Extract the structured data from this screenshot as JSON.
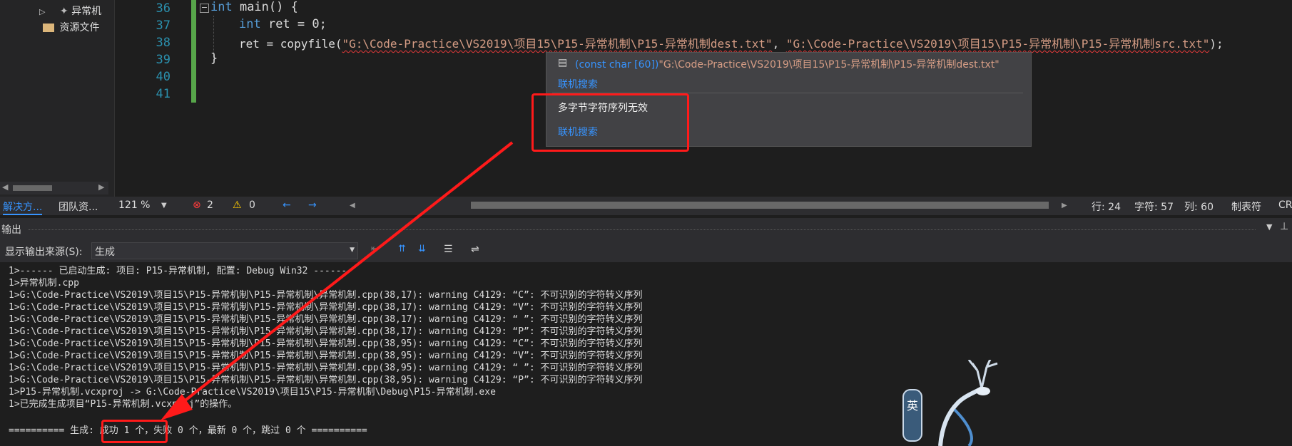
{
  "solution_explorer": {
    "items": [
      {
        "label": "异常机",
        "icon": "file-icon"
      },
      {
        "label": "资源文件",
        "icon": "folder-icon"
      }
    ],
    "tabs": [
      "解决方...",
      "团队资..."
    ]
  },
  "editor": {
    "line_numbers": [
      "36",
      "37",
      "38",
      "39",
      "40",
      "41"
    ],
    "code": {
      "l36_kw": "int",
      "l36_rest": " main() {",
      "l37_kw": "int",
      "l37_rest": " ret = 0;",
      "l38_pre": "ret = copyfile(",
      "l38_str1": "\"G:\\Code-Practice\\VS2019\\项目15\\P15-异常机制\\P15-异常机制dest.txt\"",
      "l38_mid": ", ",
      "l38_str2": "\"G:\\Code-Practice\\VS2019\\项目15\\P15-异常机制\\P15-异常机制src.txt\"",
      "l38_post": ");",
      "l39": "}"
    }
  },
  "tooltip": {
    "type_prefix": "(const char [60])",
    "value": "\"G:\\Code-Practice\\VS2019\\项目15\\P15-异常机制\\P15-异常机制dest.txt\"",
    "online_search_1": "联机搜索",
    "error_message": "多字节字符序列无效",
    "online_search_2": "联机搜索"
  },
  "editor_status": {
    "zoom": "121 %",
    "errors": "2",
    "warnings": "0",
    "row": "行: 24",
    "char": "字符: 57",
    "col": "列: 60",
    "tab_mode": "制表符",
    "line_ending": "CR"
  },
  "output_panel": {
    "title": "输出",
    "source_label": "显示输出来源(S):",
    "source_value": "生成",
    "lines": [
      "1>------ 已启动生成: 项目: P15-异常机制, 配置: Debug Win32 ------",
      "1>异常机制.cpp",
      "1>G:\\Code-Practice\\VS2019\\项目15\\P15-异常机制\\P15-异常机制\\异常机制.cpp(38,17): warning C4129: “C”: 不可识别的字符转义序列",
      "1>G:\\Code-Practice\\VS2019\\项目15\\P15-异常机制\\P15-异常机制\\异常机制.cpp(38,17): warning C4129: “V”: 不可识别的字符转义序列",
      "1>G:\\Code-Practice\\VS2019\\项目15\\P15-异常机制\\P15-异常机制\\异常机制.cpp(38,17): warning C4129: “ ”: 不可识别的字符转义序列",
      "1>G:\\Code-Practice\\VS2019\\项目15\\P15-异常机制\\P15-异常机制\\异常机制.cpp(38,17): warning C4129: “P”: 不可识别的字符转义序列",
      "1>G:\\Code-Practice\\VS2019\\项目15\\P15-异常机制\\P15-异常机制\\异常机制.cpp(38,95): warning C4129: “C”: 不可识别的字符转义序列",
      "1>G:\\Code-Practice\\VS2019\\项目15\\P15-异常机制\\P15-异常机制\\异常机制.cpp(38,95): warning C4129: “V”: 不可识别的字符转义序列",
      "1>G:\\Code-Practice\\VS2019\\项目15\\P15-异常机制\\P15-异常机制\\异常机制.cpp(38,95): warning C4129: “ ”: 不可识别的字符转义序列",
      "1>G:\\Code-Practice\\VS2019\\项目15\\P15-异常机制\\P15-异常机制\\异常机制.cpp(38,95): warning C4129: “P”: 不可识别的字符转义序列",
      "1>P15-异常机制.vcxproj -> G:\\Code-Practice\\VS2019\\项目15\\P15-异常机制\\Debug\\P15-异常机制.exe",
      "1>已完成生成项目“P15-异常机制.vcxproj”的操作。",
      "========== 生成: 成功 1 个，失败 0 个，最新 0 个，跳过 0 个 =========="
    ]
  },
  "watermark": {
    "badge_char": "英"
  },
  "colors": {
    "keyword": "#569cd6",
    "string": "#d69d85",
    "annotation": "#ff1a1a",
    "link": "#3794ff"
  }
}
